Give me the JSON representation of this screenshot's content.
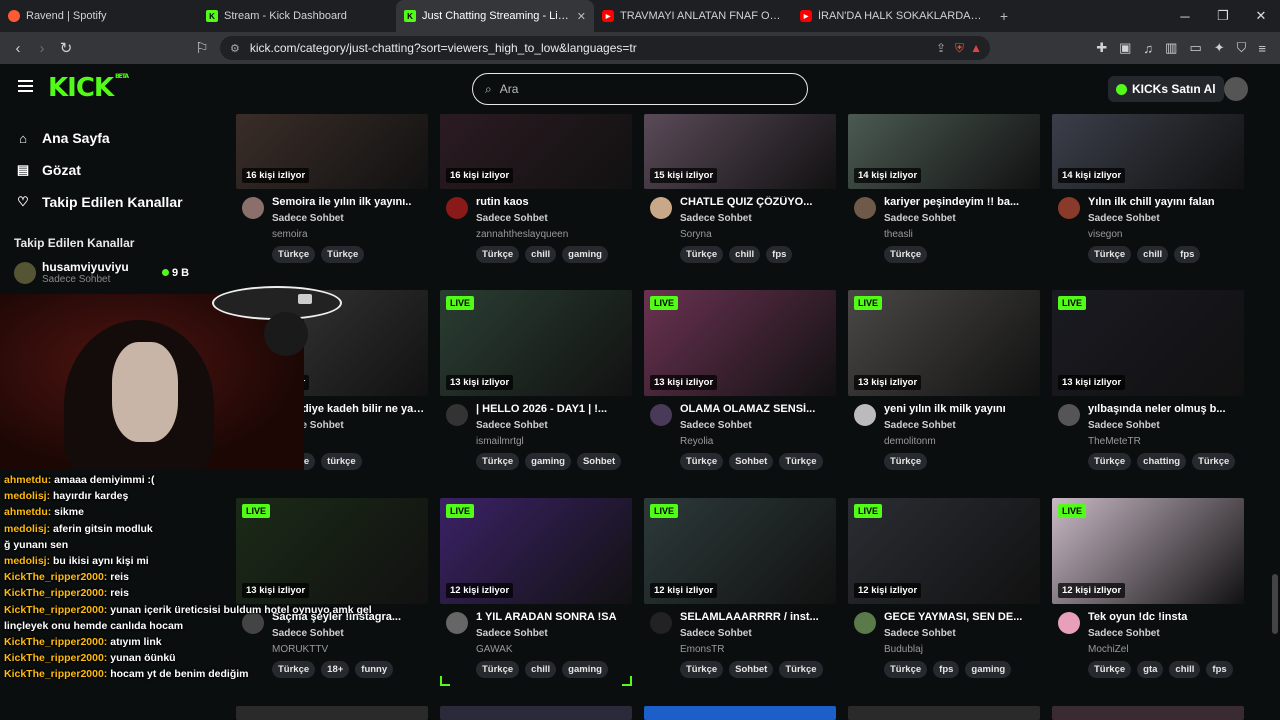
{
  "browser": {
    "tabs": [
      {
        "title": "Ravend | Spotify",
        "icon": "spotify-icon",
        "close": ""
      },
      {
        "title": "Stream - Kick Dashboard",
        "icon": "kick-icon",
        "close": ""
      },
      {
        "title": "Just Chatting Streaming - Live St",
        "icon": "kick-icon",
        "close": "✕"
      },
      {
        "title": "TRAVMAYI ANLATAN FNAF OYUNU -",
        "icon": "youtube-icon",
        "close": ""
      },
      {
        "title": "İRAN'DA HALK SOKAKLARDA, DEVRİ",
        "icon": "youtube-icon",
        "close": ""
      }
    ],
    "url": "kick.com/category/just-chatting?sort=viewers_high_to_low&languages=tr"
  },
  "header": {
    "logo": "KICK",
    "logo_beta": "BETA",
    "search_placeholder": "Ara",
    "buy_label": "KICKs Satın Al"
  },
  "sidebar": {
    "nav": [
      {
        "label": "Ana Sayfa",
        "icon": "home-icon"
      },
      {
        "label": "Gözat",
        "icon": "browse-icon"
      },
      {
        "label": "Takip Edilen Kanallar",
        "icon": "heart-icon"
      }
    ],
    "followed_title": "Takip Edilen Kanallar",
    "followed": [
      {
        "name": "husamviyuviyu",
        "category": "Sadece Sohbet",
        "viewers": "9 B"
      }
    ]
  },
  "overlay": {
    "chat": [
      {
        "user": "ahmetdu:",
        "text": "amaaa demiyimmi :("
      },
      {
        "user": "medolisj:",
        "text": "hayırdır kardeş"
      },
      {
        "user": "ahmetdu:",
        "text": "sikme"
      },
      {
        "user": "medolisj:",
        "text": "aferin gitsin modluk"
      },
      {
        "user": "",
        "text": "ğ yunanı sen"
      },
      {
        "user": "medolisj:",
        "text": "bu ikisi aynı kişi mi"
      },
      {
        "user": "KickThe_ripper2000:",
        "text": "reis"
      },
      {
        "user": "KickThe_ripper2000:",
        "text": "reis"
      },
      {
        "user": "KickThe_ripper2000:",
        "text": "yunan içerik üreticsisi buldum hotel oynuyo amk gel"
      },
      {
        "user": "",
        "text": "linçleyek onu hemde canlıda hocam"
      },
      {
        "user": "KickThe_ripper2000:",
        "text": "atıyım link"
      },
      {
        "user": "KickThe_ripper2000:",
        "text": "yunan öünkü"
      },
      {
        "user": "KickThe_ripper2000:",
        "text": "hocam yt de benim dediğim"
      }
    ]
  },
  "streams": [
    {
      "live": "",
      "viewers": "16 kişi izliyor",
      "title": "Semoira ile yılın ilk yayını..",
      "category": "Sadece Sohbet",
      "channel": "semoira",
      "tags": [
        "Türkçe",
        "Türkçe"
      ],
      "thumb": "#3a2d28",
      "avatar": "#8b6f6a"
    },
    {
      "live": "",
      "viewers": "16 kişi izliyor",
      "title": "rutin kaos",
      "category": "Sadece Sohbet",
      "channel": "zannahtheslayqueen",
      "tags": [
        "Türkçe",
        "chill",
        "gaming"
      ],
      "thumb": "#2b1b22",
      "avatar": "#8a1a1a"
    },
    {
      "live": "",
      "viewers": "15 kişi izliyor",
      "title": "CHATLE QUIZ ÇÖZÜYO...",
      "category": "Sadece Sohbet",
      "channel": "Soryna",
      "tags": [
        "Türkçe",
        "chill",
        "fps"
      ],
      "thumb": "#5a4a58",
      "avatar": "#c9a88a"
    },
    {
      "live": "",
      "viewers": "14 kişi izliyor",
      "title": "kariyer peşindeyim !! ba...",
      "category": "Sadece Sohbet",
      "channel": "theasli",
      "tags": [
        "Türkçe"
      ],
      "thumb": "#4b5a52",
      "avatar": "#6f5a4a"
    },
    {
      "live": "",
      "viewers": "14 kişi izliyor",
      "title": "Yılın ilk chill yayını falan",
      "category": "Sadece Sohbet",
      "channel": "visegon",
      "tags": [
        "Türkçe",
        "chill",
        "fps"
      ],
      "thumb": "#3b3f4a",
      "avatar": "#8a3a2a"
    },
    {
      "live": "LIVE",
      "viewers": "13 kişi izliyor",
      "title": "hitler diye kadeh bilir ne yaşadığını",
      "category": "Sadece Sohbet",
      "channel": "uyum",
      "tags": [
        "Türkçe",
        "türkçe"
      ],
      "thumb": "#3a3a3a",
      "avatar": "#777"
    },
    {
      "live": "LIVE",
      "viewers": "13 kişi izliyor",
      "title": "| HELLO 2026 - DAY1 | !...",
      "category": "Sadece Sohbet",
      "channel": "ismailmrtgl",
      "tags": [
        "Türkçe",
        "gaming",
        "Sohbet"
      ],
      "thumb": "#2a3e33",
      "avatar": "#333"
    },
    {
      "live": "LIVE",
      "viewers": "13 kişi izliyor",
      "title": "OLAMA OLAMAZ SENSİ...",
      "category": "Sadece Sohbet",
      "channel": "Reyolia",
      "tags": [
        "Türkçe",
        "Sohbet",
        "Türkçe"
      ],
      "thumb": "#6a3252",
      "avatar": "#4a3a5a"
    },
    {
      "live": "LIVE",
      "viewers": "13 kişi izliyor",
      "title": "yeni yılın ilk milk yayını",
      "category": "Sadece Sohbet",
      "channel": "demolitonm",
      "tags": [
        "Türkçe"
      ],
      "thumb": "#4a4846",
      "avatar": "#bbb"
    },
    {
      "live": "LIVE",
      "viewers": "13 kişi izliyor",
      "title": "yılbaşında neler olmuş b...",
      "category": "Sadece Sohbet",
      "channel": "TheMeteTR",
      "tags": [
        "Türkçe",
        "chatting",
        "Türkçe"
      ],
      "thumb": "#1a1a22",
      "avatar": "#555"
    },
    {
      "live": "LIVE",
      "viewers": "13 kişi izliyor",
      "title": "Saçma şeyler !instagra...",
      "category": "Sadece Sohbet",
      "channel": "MORUKTTV",
      "tags": [
        "Türkçe",
        "18+",
        "funny"
      ],
      "thumb": "#1b2a17",
      "avatar": "#444"
    },
    {
      "live": "LIVE",
      "viewers": "12 kişi izliyor",
      "title": "1 YIL ARADAN SONRA !SA",
      "category": "Sadece Sohbet",
      "channel": "GAWAK",
      "tags": [
        "Türkçe",
        "chill",
        "gaming"
      ],
      "thumb": "#3b2266",
      "avatar": "#666"
    },
    {
      "live": "LIVE",
      "viewers": "12 kişi izliyor",
      "title": "SELAMLAAARRRR / inst...",
      "category": "Sadece Sohbet",
      "channel": "EmonsTR",
      "tags": [
        "Türkçe",
        "Sohbet",
        "Türkçe"
      ],
      "thumb": "#2d3a3a",
      "avatar": "#222"
    },
    {
      "live": "LIVE",
      "viewers": "12 kişi izliyor",
      "title": "GECE YAYMASI, SEN DE...",
      "category": "Sadece Sohbet",
      "channel": "Budublaj",
      "tags": [
        "Türkçe",
        "fps",
        "gaming"
      ],
      "thumb": "#2a2d33",
      "avatar": "#5a7a4a"
    },
    {
      "live": "LIVE",
      "viewers": "12 kişi izliyor",
      "title": "Tek oyun !dc !insta",
      "category": "Sadece Sohbet",
      "channel": "MochiZel",
      "tags": [
        "Türkçe",
        "gta",
        "chill",
        "fps"
      ],
      "thumb": "#c9b9c6",
      "avatar": "#e8a0b8"
    }
  ]
}
